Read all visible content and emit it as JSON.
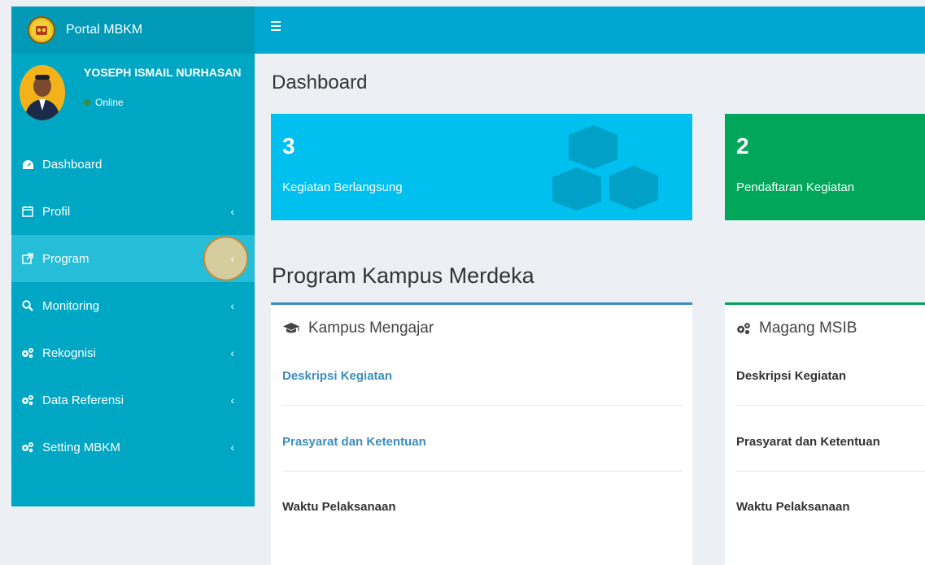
{
  "brand": {
    "name": "Portal MBKM"
  },
  "user": {
    "name": "YOSEPH ISMAIL NURHASAN",
    "status": "Online"
  },
  "menu": [
    {
      "label": "Dashboard",
      "icon": "dashboard-icon",
      "has_chevron": false
    },
    {
      "label": "Profil",
      "icon": "calendar-icon",
      "has_chevron": true
    },
    {
      "label": "Program",
      "icon": "external-link-icon",
      "has_chevron": true,
      "active": true
    },
    {
      "label": "Monitoring",
      "icon": "search-icon",
      "has_chevron": true
    },
    {
      "label": "Rekognisi",
      "icon": "gears-icon",
      "has_chevron": true
    },
    {
      "label": "Data Referensi",
      "icon": "gears-icon",
      "has_chevron": true
    },
    {
      "label": "Setting MBKM",
      "icon": "gears-icon",
      "has_chevron": true
    }
  ],
  "chevron": "‹",
  "page_title": "Dashboard",
  "stats": [
    {
      "number": "3",
      "label": "Kegiatan Berlangsung",
      "color": "#00c0ef"
    },
    {
      "number": "2",
      "label": "Pendaftaran Kegiatan",
      "color": "#00a65a"
    }
  ],
  "section_title": "Program Kampus Merdeka",
  "programs": [
    {
      "title": "Kampus Mengajar",
      "icon": "graduation-cap-icon",
      "accent": "#3c8dbc",
      "links": [
        "Deskripsi Kegiatan",
        "Prasyarat dan Ketentuan",
        "Waktu Pelaksanaan"
      ],
      "link_colors": [
        "#3c8dbc",
        "#3c8dbc",
        "#333333"
      ]
    },
    {
      "title": "Magang MSIB",
      "icon": "gears-icon",
      "accent": "#00a65a",
      "links": [
        "Deskripsi Kegiatan",
        "Prasyarat dan Ketentuan",
        "Waktu Pelaksanaan"
      ],
      "link_colors": [
        "#333333",
        "#333333",
        "#333333"
      ]
    }
  ]
}
